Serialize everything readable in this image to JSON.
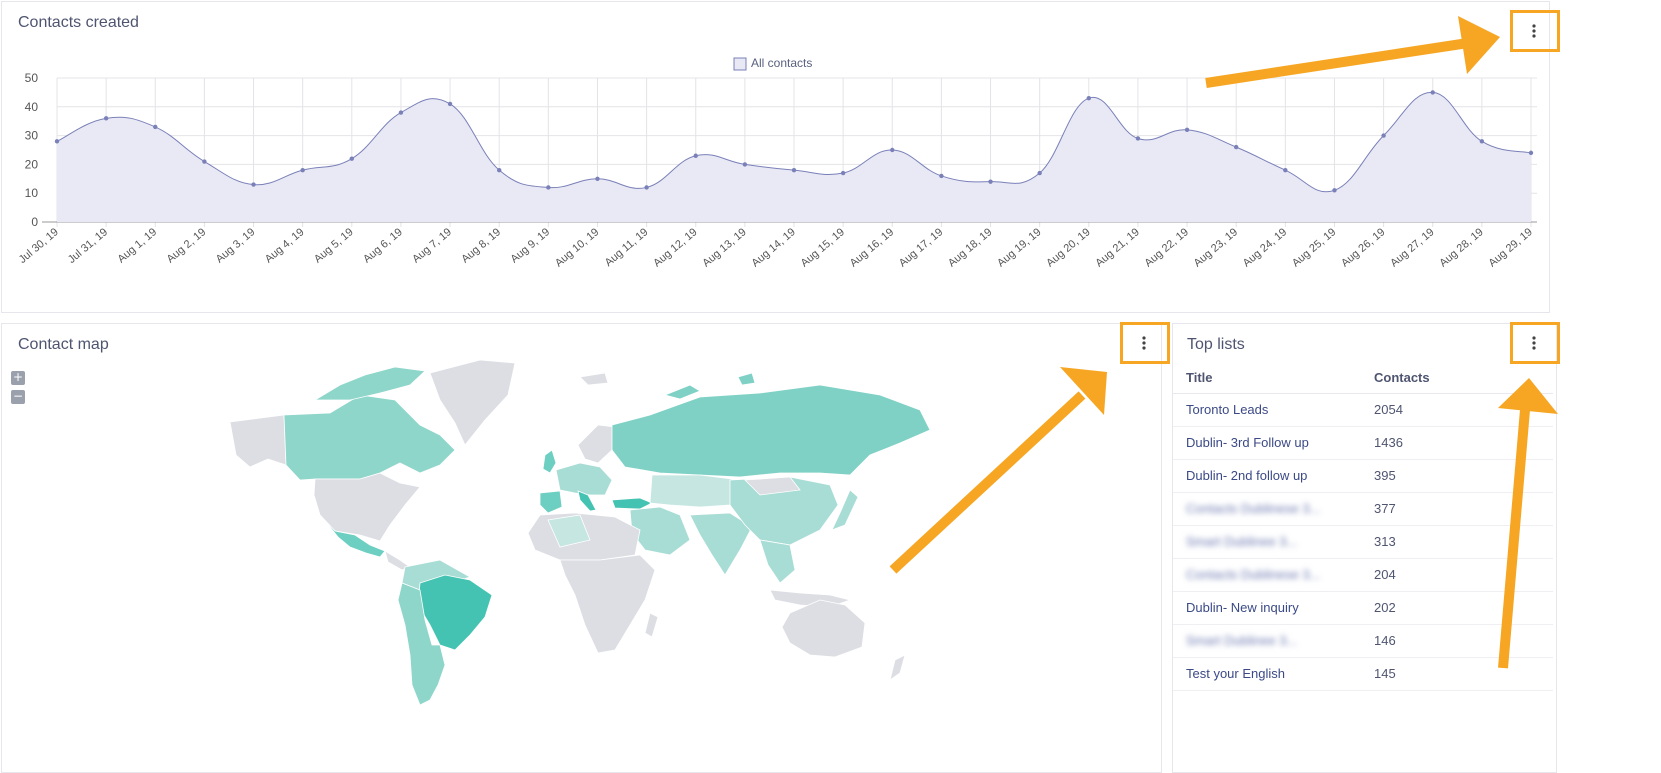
{
  "contacts_chart": {
    "title": "Contacts created",
    "legend": "All contacts"
  },
  "chart_data": {
    "type": "area",
    "series": [
      {
        "name": "All contacts",
        "values": [
          28,
          36,
          33,
          21,
          13,
          18,
          22,
          38,
          41,
          18,
          12,
          15,
          12,
          23,
          20,
          18,
          17,
          25,
          16,
          14,
          17,
          43,
          29,
          32,
          26,
          18,
          11,
          30,
          45,
          28,
          24
        ]
      }
    ],
    "categories": [
      "Jul 30, 19",
      "Jul 31, 19",
      "Aug 1, 19",
      "Aug 2, 19",
      "Aug 3, 19",
      "Aug 4, 19",
      "Aug 5, 19",
      "Aug 6, 19",
      "Aug 7, 19",
      "Aug 8, 19",
      "Aug 9, 19",
      "Aug 10, 19",
      "Aug 11, 19",
      "Aug 12, 19",
      "Aug 13, 19",
      "Aug 14, 19",
      "Aug 15, 19",
      "Aug 16, 19",
      "Aug 17, 19",
      "Aug 18, 19",
      "Aug 19, 19",
      "Aug 20, 19",
      "Aug 21, 19",
      "Aug 22, 19",
      "Aug 23, 19",
      "Aug 24, 19",
      "Aug 25, 19",
      "Aug 26, 19",
      "Aug 27, 19",
      "Aug 28, 19",
      "Aug 29, 19"
    ],
    "yticks": [
      "0",
      "10",
      "20",
      "30",
      "40",
      "50"
    ],
    "ylim": [
      0,
      50
    ],
    "grid": true,
    "legend_position": "top"
  },
  "contact_map": {
    "title": "Contact map",
    "zoom_in": "+",
    "zoom_out": "−"
  },
  "top_lists": {
    "title": "Top lists",
    "col_title": "Title",
    "col_contacts": "Contacts",
    "rows": [
      {
        "title": "Toronto Leads",
        "contacts": "2054"
      },
      {
        "title": "Dublin- 3rd Follow up",
        "contacts": "1436"
      },
      {
        "title": "Dublin- 2nd follow up",
        "contacts": "395"
      },
      {
        "title": "Contacts Dublinese 3...",
        "contacts": "377"
      },
      {
        "title": "Smart Dublinee 3...",
        "contacts": "313"
      },
      {
        "title": "Contacts Dublinese 3...",
        "contacts": "204"
      },
      {
        "title": "Dublin- New inquiry",
        "contacts": "202"
      },
      {
        "title": "Smart Dublinee 3...",
        "contacts": "146"
      },
      {
        "title": "Test your English",
        "contacts": "145"
      }
    ]
  },
  "colors": {
    "line": "#7a80b8",
    "fill": "#e9e9f5",
    "highlight": "#f6a623",
    "map_default": "#dcdee3",
    "map_mid": "#7fd1c5",
    "map_strong": "#45c3b2",
    "map_light": "#a8ddd5"
  },
  "icons": {
    "menu": "kebab-menu-icon"
  }
}
